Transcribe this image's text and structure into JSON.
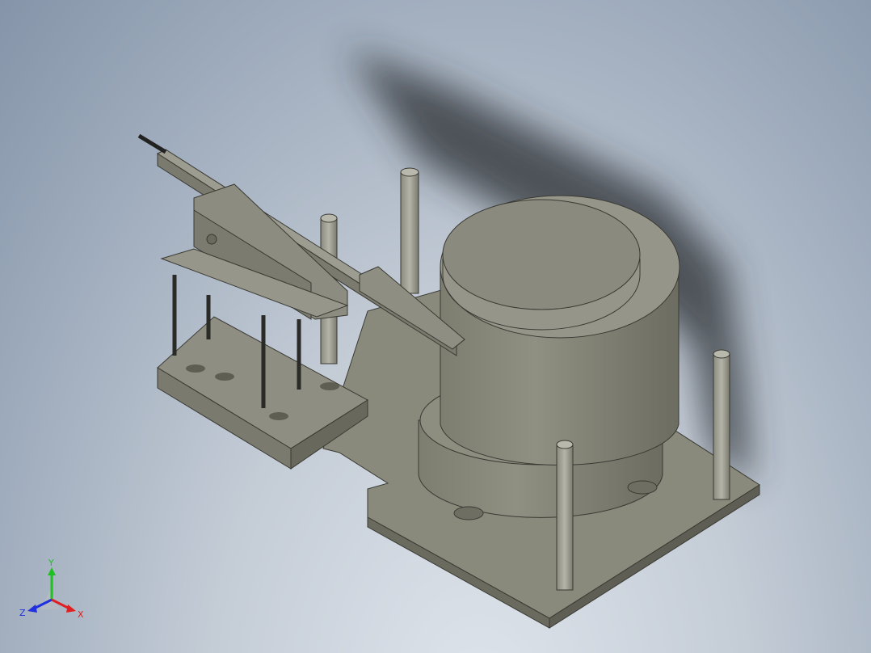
{
  "view": {
    "background_top": "#8594a8",
    "background_bottom": "#dfe5ec",
    "model_color": "#8a8a7c"
  },
  "triad": {
    "x_label": "X",
    "y_label": "Y",
    "z_label": "Z",
    "x_color": "#e02020",
    "y_color": "#20c020",
    "z_color": "#2030e0"
  }
}
